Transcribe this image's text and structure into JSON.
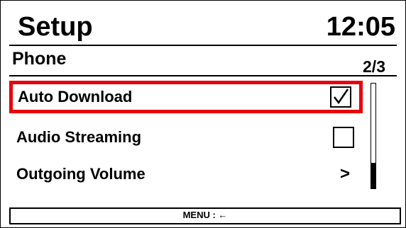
{
  "header": {
    "title": "Setup",
    "clock": "12:05"
  },
  "section": {
    "title": "Phone",
    "page_indicator": "2/3"
  },
  "menu_items": [
    {
      "label": "Auto Download",
      "control": "checkbox",
      "checked": true,
      "selected": true
    },
    {
      "label": "Audio Streaming",
      "control": "checkbox",
      "checked": false,
      "selected": false
    },
    {
      "label": "Outgoing Volume",
      "control": "submenu",
      "indicator": ">",
      "selected": false
    }
  ],
  "scrollbar": {
    "position_fraction": 1.0,
    "visible_fraction": 0.25
  },
  "footer": {
    "hint": "MENU : ←"
  },
  "colors": {
    "selection_border": "#e8000b",
    "foreground": "#000000",
    "background": "#ffffff"
  }
}
